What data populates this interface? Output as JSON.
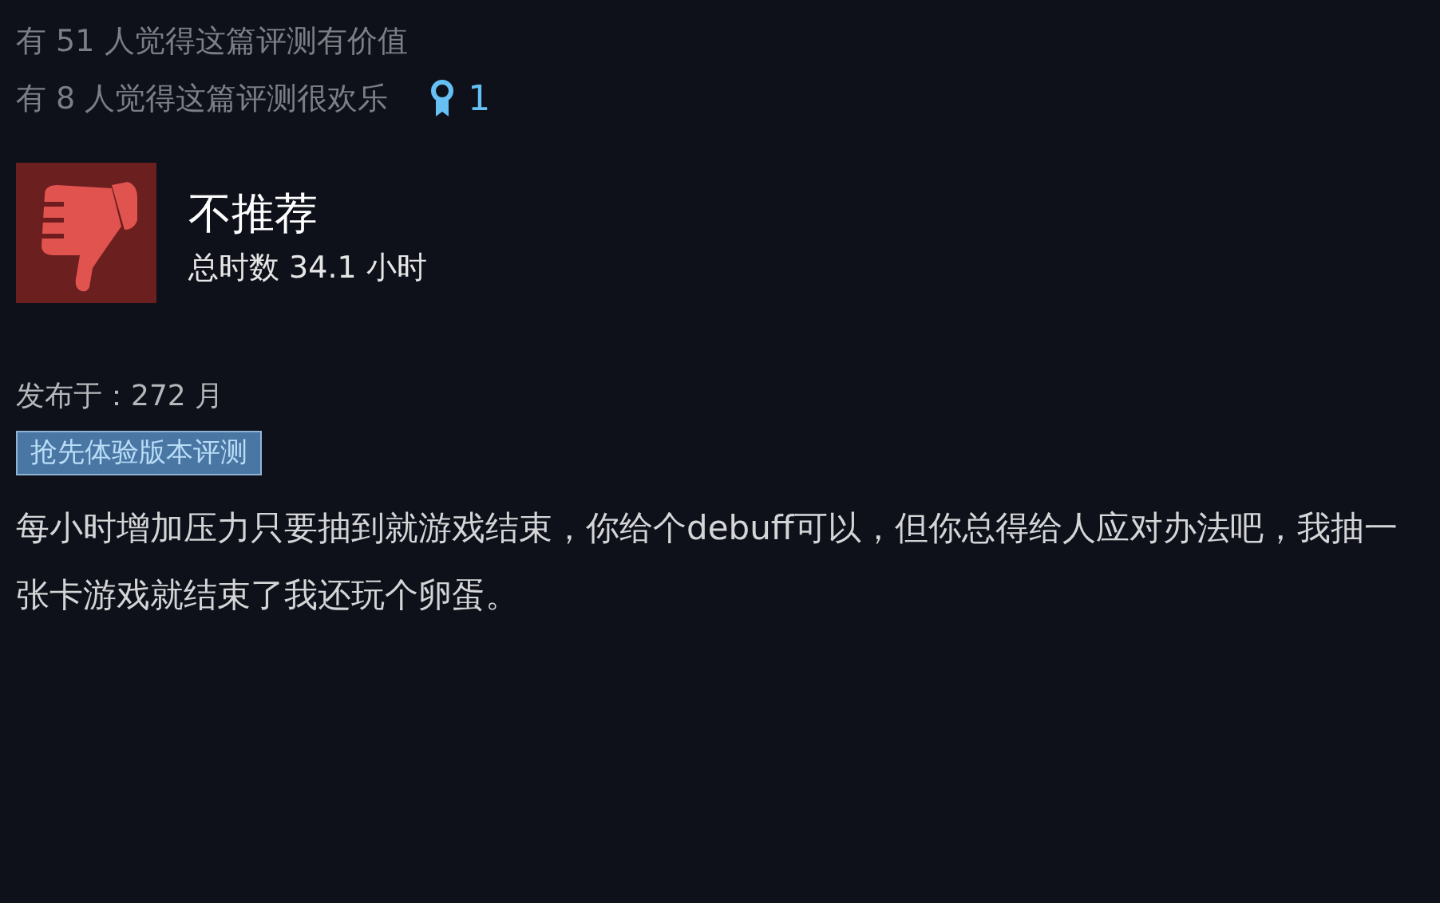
{
  "votes": {
    "helpful": "有 51 人觉得这篇评测有价值",
    "funny": "有 8 人觉得这篇评测很欢乐",
    "award_count": "1"
  },
  "review": {
    "recommended": false,
    "verdict": "不推荐",
    "hours": "总时数 34.1 小时"
  },
  "posted": "发布于：272 月",
  "tag": "抢先体验版本评测",
  "body": "每小时增加压力只要抽到就游戏结束，你给个debuff可以，但你总得给人应对办法吧，我抽一张卡游戏就结束了我还玩个卵蛋。"
}
